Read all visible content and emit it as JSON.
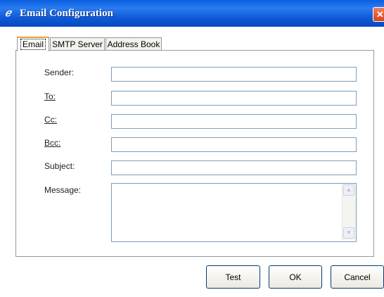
{
  "window": {
    "title": "Email Configuration",
    "close_glyph": "✕",
    "icon": "app-icon"
  },
  "tabs": [
    {
      "label": "Email",
      "active": true
    },
    {
      "label": "SMTP Server",
      "active": false
    },
    {
      "label": "Address Book",
      "active": false
    }
  ],
  "form": {
    "sender_label": "Sender:",
    "to_label": "To:",
    "cc_label": "Cc:",
    "bcc_label": "Bcc:",
    "subject_label": "Subject:",
    "message_label": "Message:",
    "sender_value": "",
    "to_value": "",
    "cc_value": "",
    "bcc_value": "",
    "subject_value": "",
    "message_value": ""
  },
  "buttons": {
    "test": "Test",
    "ok": "OK",
    "cancel": "Cancel"
  },
  "colors": {
    "titlebar": "#0a5fe0",
    "panel_border": "#919b9c",
    "field_border": "#7f9db9"
  }
}
